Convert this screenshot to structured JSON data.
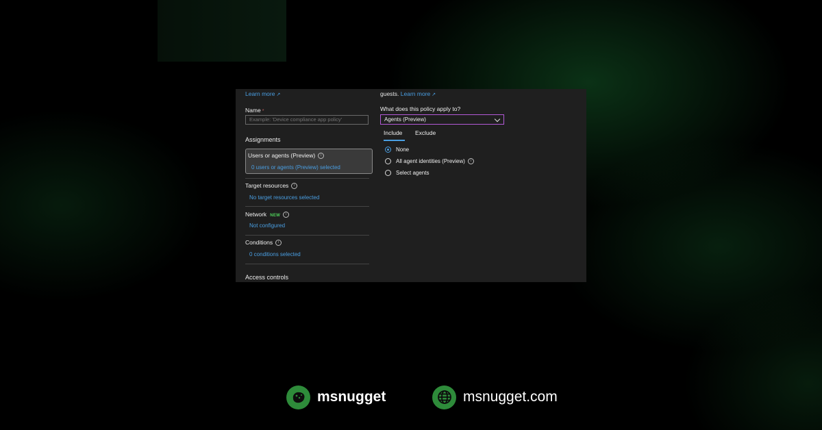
{
  "left": {
    "learn_more": "Learn more",
    "name_label": "Name",
    "name_required": "*",
    "name_placeholder": "Example: 'Device compliance app policy'",
    "assignments_title": "Assignments",
    "users_label": "Users or agents (Preview)",
    "users_value": "0 users or agents (Preview) selected",
    "target_label": "Target resources",
    "target_value": "No target resources selected",
    "network_label": "Network",
    "network_badge": "NEW",
    "network_value": "Not configured",
    "conditions_label": "Conditions",
    "conditions_value": "0 conditions selected",
    "access_controls_title": "Access controls"
  },
  "right": {
    "guests_text": "guests.",
    "learn_more": "Learn more",
    "apply_question": "What does this policy apply to?",
    "apply_selected": "Agents (Preview)",
    "tabs": [
      "Include",
      "Exclude"
    ],
    "options": [
      {
        "label": "None",
        "selected": true
      },
      {
        "label": "All agent identities (Preview)",
        "selected": false
      },
      {
        "label": "Select agents",
        "selected": false
      }
    ]
  },
  "footer": {
    "brand_name": "msnugget",
    "brand_icon": "nugget-icon",
    "site": "msnugget.com",
    "site_icon": "globe-icon"
  },
  "colors": {
    "accent": "#4a9fe3",
    "brand_green": "#2e8b3a",
    "select_border": "#b45ad8",
    "badge_green": "#4fd05a"
  }
}
